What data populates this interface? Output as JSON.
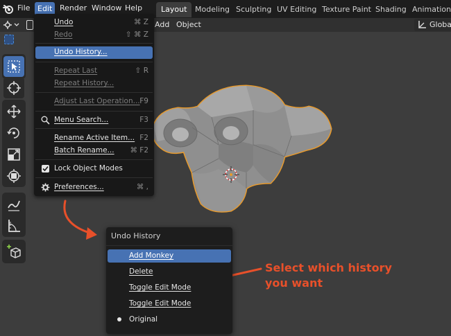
{
  "menubar": {
    "items": [
      "File",
      "Edit",
      "Render",
      "Window",
      "Help"
    ],
    "active": "Edit"
  },
  "workspaces": {
    "tabs": [
      "Layout",
      "Modeling",
      "Sculpting",
      "UV Editing",
      "Texture Paint",
      "Shading",
      "Animation"
    ],
    "active": "Layout"
  },
  "header": {
    "add_label": "Add",
    "object_label": "Object",
    "transform_orientation": "Global"
  },
  "edit_menu": {
    "items": [
      {
        "label": "Undo",
        "shortcut": "⌘ Z",
        "dim": false
      },
      {
        "label": "Redo",
        "shortcut": "⇧ ⌘ Z",
        "dim": true
      },
      {
        "label": "Undo History...",
        "shortcut": "",
        "highlighted": true
      },
      {
        "label": "Repeat Last",
        "shortcut": "⇧ R",
        "dim": true
      },
      {
        "label": "Repeat History...",
        "shortcut": "",
        "dim": true
      },
      {
        "label": "Adjust Last Operation...",
        "shortcut": "F9",
        "dim": true
      },
      {
        "label": "Menu Search...",
        "shortcut": "F3",
        "icon": "search-icon"
      },
      {
        "label": "Rename Active Item...",
        "shortcut": "F2"
      },
      {
        "label": "Batch Rename...",
        "shortcut": "⌘ F2"
      },
      {
        "label": "Lock Object Modes",
        "shortcut": "",
        "icon": "checkbox-checked-icon"
      },
      {
        "label": "Preferences...",
        "shortcut": "⌘ ,",
        "icon": "gear-icon"
      }
    ]
  },
  "undo_history": {
    "title": "Undo History",
    "items": [
      {
        "label": "Add Monkey",
        "highlighted": true
      },
      {
        "label": "Delete"
      },
      {
        "label": "Toggle Edit Mode"
      },
      {
        "label": "Toggle Edit Mode"
      },
      {
        "label": "Original",
        "current": true
      }
    ]
  },
  "annotation": {
    "line1": "Select which history",
    "line2": "you want"
  },
  "colors": {
    "accent": "#4772b3",
    "annotation": "#e8502a",
    "selection_outline": "#e89a2c",
    "menu_bg": "#181818",
    "viewport_bg": "#3d3d3d"
  }
}
